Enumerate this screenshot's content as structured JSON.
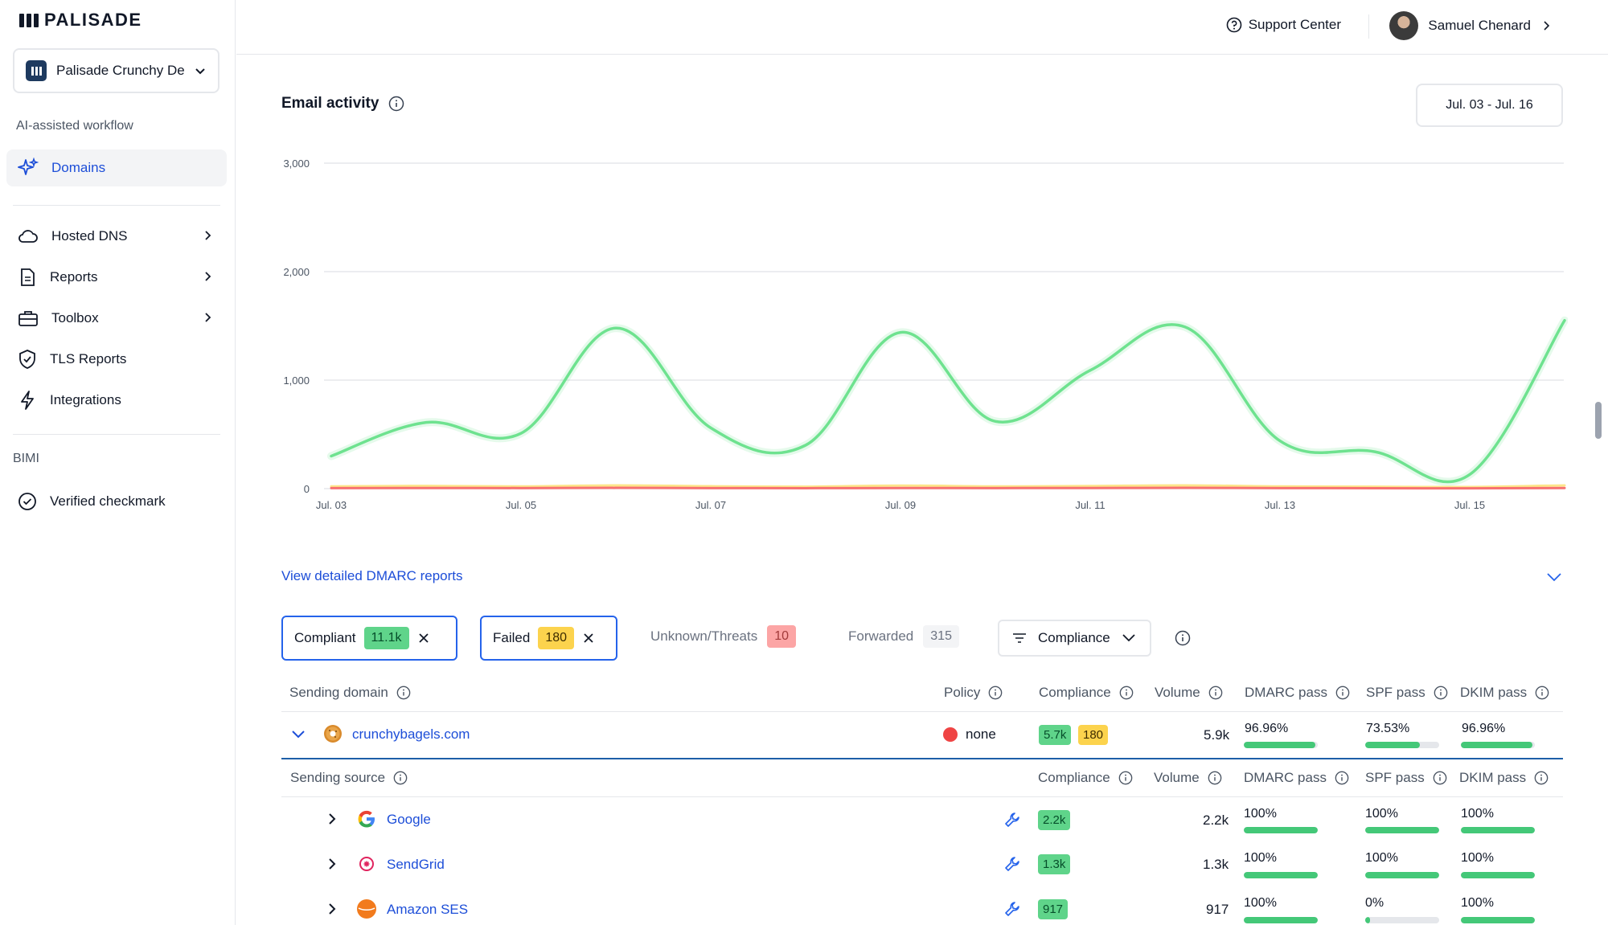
{
  "brand": {
    "name": "PALISADE"
  },
  "sidebar": {
    "org_name": "Palisade Crunchy Der",
    "section_ai": "AI-assisted workflow",
    "items": [
      {
        "label": "Domains"
      },
      {
        "label": "Hosted DNS"
      },
      {
        "label": "Reports"
      },
      {
        "label": "Toolbox"
      },
      {
        "label": "TLS Reports"
      },
      {
        "label": "Integrations"
      }
    ],
    "section_bimi": "BIMI",
    "bimi_items": [
      {
        "label": "Verified checkmark"
      }
    ]
  },
  "header": {
    "support": "Support Center",
    "user_name": "Samuel Chenard"
  },
  "activity": {
    "title": "Email activity",
    "date_range": "Jul. 03 - Jul. 16"
  },
  "chart_data": {
    "type": "line",
    "x": [
      "Jul. 03",
      "Jul. 04",
      "Jul. 05",
      "Jul. 06",
      "Jul. 07",
      "Jul. 08",
      "Jul. 09",
      "Jul. 10",
      "Jul. 11",
      "Jul. 12",
      "Jul. 13",
      "Jul. 14",
      "Jul. 15",
      "Jul. 16"
    ],
    "x_tick_labels": [
      "Jul. 03",
      "Jul. 05",
      "Jul. 07",
      "Jul. 09",
      "Jul. 11",
      "Jul. 13",
      "Jul. 15"
    ],
    "y_ticks": [
      "0",
      "1,000",
      "2,000",
      "3,000"
    ],
    "ylim": [
      0,
      3000
    ],
    "grid": true,
    "series": [
      {
        "color": "#6ee28f",
        "values": [
          300,
          610,
          510,
          1480,
          560,
          400,
          1440,
          620,
          1090,
          1490,
          440,
          340,
          130,
          1550
        ]
      },
      {
        "color": "#fde68a",
        "values": [
          20,
          25,
          20,
          30,
          22,
          18,
          28,
          20,
          24,
          30,
          20,
          18,
          15,
          30
        ]
      },
      {
        "color": "#f87171",
        "values": [
          5,
          6,
          5,
          7,
          5,
          4,
          6,
          5,
          6,
          7,
          5,
          4,
          3,
          6
        ]
      }
    ]
  },
  "dmarc_link": "View detailed DMARC reports",
  "filters": {
    "compliant": {
      "label": "Compliant",
      "count": "11.1k"
    },
    "failed": {
      "label": "Failed",
      "count": "180"
    },
    "unknown": {
      "label": "Unknown/Threats",
      "count": "10"
    },
    "forwarded": {
      "label": "Forwarded",
      "count": "315"
    },
    "sort": "Compliance"
  },
  "table": {
    "headers": {
      "sending_domain": "Sending domain",
      "policy": "Policy",
      "compliance": "Compliance",
      "volume": "Volume",
      "dmarc": "DMARC pass",
      "spf": "SPF pass",
      "dkim": "DKIM pass"
    },
    "domain_row": {
      "domain": "crunchybagels.com",
      "policy": "none",
      "compliant": "5.7k",
      "failed": "180",
      "volume": "5.9k",
      "dmarc": "96.96%",
      "spf": "73.53%",
      "dkim": "96.96%",
      "dmarc_frac": 0.9696,
      "spf_frac": 0.7353,
      "dkim_frac": 0.9696
    },
    "source_headers": {
      "sending_source": "Sending source",
      "compliance": "Compliance",
      "volume": "Volume",
      "dmarc": "DMARC pass",
      "spf": "SPF pass",
      "dkim": "DKIM pass"
    },
    "sources": [
      {
        "name": "Google",
        "compliance": "2.2k",
        "volume": "2.2k",
        "dmarc": "100%",
        "spf": "100%",
        "dkim": "100%",
        "dmarc_frac": 1,
        "spf_frac": 1,
        "dkim_frac": 1
      },
      {
        "name": "SendGrid",
        "compliance": "1.3k",
        "volume": "1.3k",
        "dmarc": "100%",
        "spf": "100%",
        "dkim": "100%",
        "dmarc_frac": 1,
        "spf_frac": 1,
        "dkim_frac": 1
      },
      {
        "name": "Amazon SES",
        "compliance": "917",
        "volume": "917",
        "dmarc": "100%",
        "spf": "0%",
        "dkim": "100%",
        "dmarc_frac": 1,
        "spf_frac": 0.06,
        "dkim_frac": 1
      }
    ]
  }
}
